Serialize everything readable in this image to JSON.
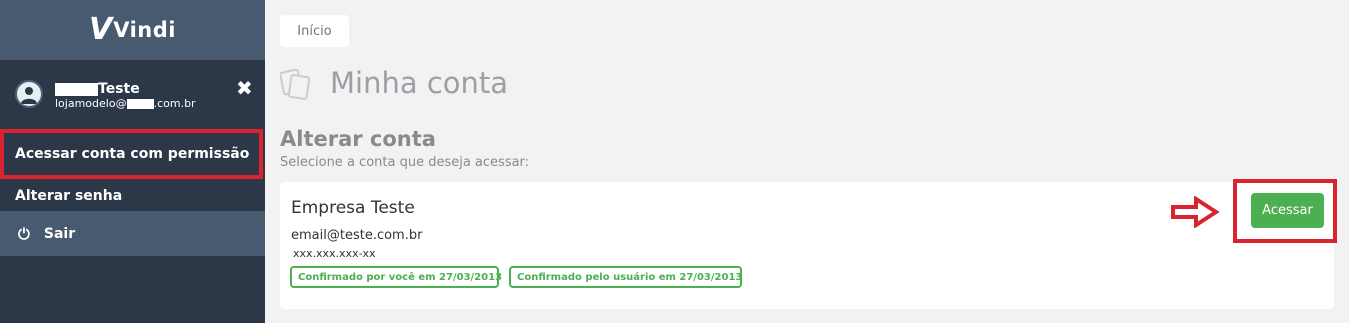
{
  "app": {
    "logo_mark": "V",
    "logo_text": "Vindi"
  },
  "colors": {
    "sidebar_bg": "#2c3847",
    "sidebar_header_bg": "#485a70",
    "accent_green": "#4caf50",
    "highlight_red": "#d9232e",
    "page_bg": "#f2f2f2"
  },
  "user": {
    "name": "Teste",
    "email_prefix": "lojamodelo@",
    "email_suffix": ".com.br"
  },
  "icons": {
    "avatar": "user-avatar-icon",
    "close": "close-icon",
    "logout": "power-icon",
    "page": "pages-icon",
    "arrow": "arrow-right-icon"
  },
  "sidebar": {
    "close_glyph": "✖",
    "items": [
      {
        "label": "Acessar conta com permissão"
      },
      {
        "label": "Alterar senha"
      },
      {
        "label": "Sair",
        "icon_glyph": "⏻"
      }
    ]
  },
  "breadcrumb": {
    "home": "Início"
  },
  "page": {
    "title": "Minha conta",
    "section_title": "Alterar conta",
    "section_subtitle": "Selecione a conta que deseja acessar:"
  },
  "account": {
    "company": "Empresa Teste",
    "email": "email@teste.com.br",
    "document": "xxx.xxx.xxx-xx",
    "badges": [
      "Confirmado por você em 27/03/2013",
      "Confirmado pelo usuário em 27/03/2013"
    ],
    "access_label": "Acessar"
  }
}
